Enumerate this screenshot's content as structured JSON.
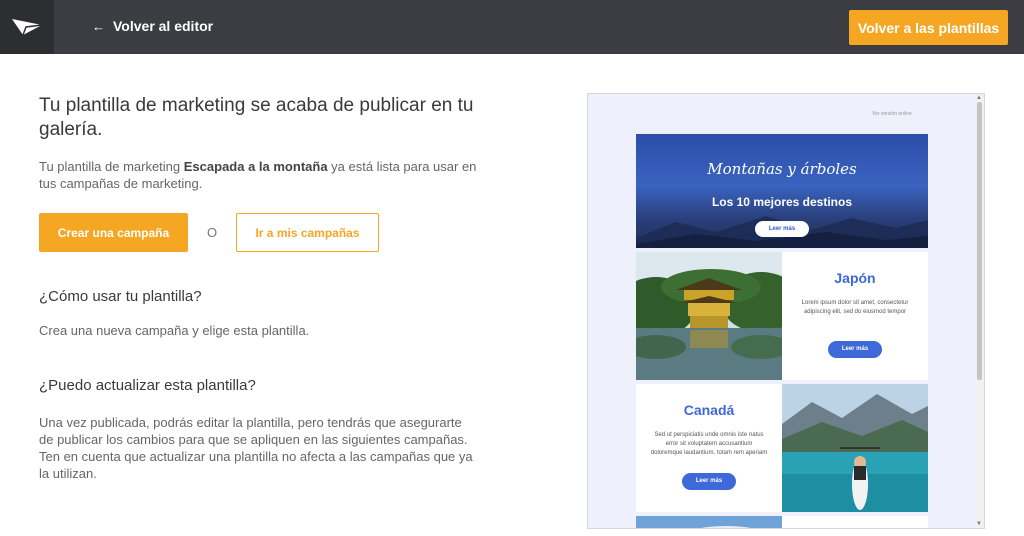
{
  "header": {
    "back_label": "Volver al editor",
    "back_arrow": "←",
    "templates_button": "Volver a las plantillas"
  },
  "main": {
    "title": "Tu plantilla de marketing se acaba de publicar en tu galería.",
    "desc_prefix": "Tu plantilla de marketing ",
    "template_name": "Escapada a la montaña",
    "desc_suffix": " ya está lista para usar en tus campañas de marketing.",
    "create_button": "Crear una campaña",
    "or": "O",
    "campaigns_button": "Ir a mis campañas",
    "faq1_title": "¿Cómo usar tu plantilla?",
    "faq1_text": "Crea una nueva campaña y elige esta plantilla.",
    "faq2_title": "¿Puedo actualizar esta plantilla?",
    "faq2_text": "Una vez publicada, podrás editar la plantilla, pero tendrás que asegurarte de publicar los cambios para que se apliquen en las siguientes campañas. Ten en cuenta que actualizar una plantilla no afecta a las campañas que ya la utilizan."
  },
  "preview": {
    "web_version": "Ver versión online",
    "hero_title": "Montañas y árboles",
    "hero_subtitle": "Los 10 mejores destinos",
    "read_more": "Leer más",
    "item1_title": "Japón",
    "item1_text": "Lorem ipsum dolor sit amet, consectetur adipiscing elit, sed do eiusmod tempor",
    "item2_title": "Canadá",
    "item2_text": "Sed ut perspiciatis unde omnis iste natus error sit voluptatem accusantium doloremque laudantium, totam rem aperiam"
  },
  "colors": {
    "accent": "#f5a623",
    "topbar": "#3c3d42",
    "link_blue": "#3f68d8"
  }
}
